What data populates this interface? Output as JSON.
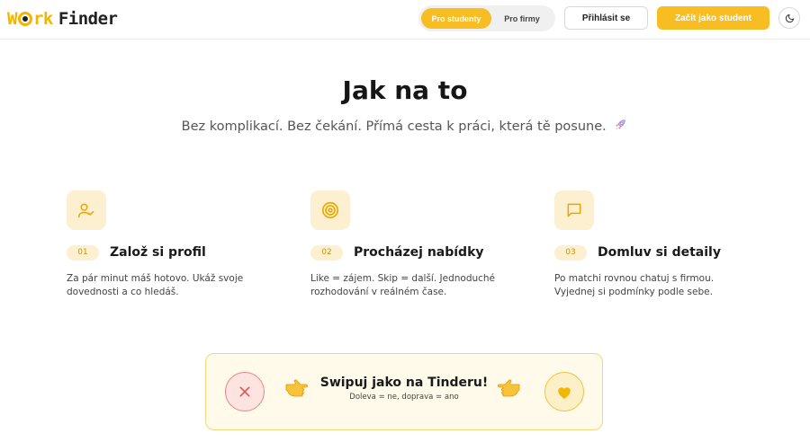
{
  "header": {
    "logo": {
      "part1": "W",
      "part2": "rk",
      "part3": "Finder"
    },
    "toggle": {
      "active": "Pro studenty",
      "inactive": "Pro firmy"
    },
    "login_label": "Přihlásit se",
    "start_label": "Začít jako student",
    "theme_icon": "moon-icon"
  },
  "hero": {
    "title": "Jak na to",
    "subtitle": "Bez komplikací. Bez čekání. Přímá cesta k práci, která tě posune."
  },
  "steps": [
    {
      "num": "01",
      "title": "Založ si profil",
      "desc": "Za pár minut máš hotovo. Ukáž svoje dovednosti a co hledáš.",
      "icon": "user-check-icon"
    },
    {
      "num": "02",
      "title": "Procházej nabídky",
      "desc": "Like = zájem. Skip = další. Jednoduché rozhodování v reálném čase.",
      "icon": "target-icon"
    },
    {
      "num": "03",
      "title": "Domluv si detaily",
      "desc": "Po matchi rovnou chatuj s firmou. Vyjednej si podmínky podle sebe.",
      "icon": "message-icon"
    }
  ],
  "swipe": {
    "title": "Swipuj jako na Tinderu!",
    "subtitle": "Doleva = ne, doprava = ano",
    "left_icon": "close-icon",
    "right_icon": "heart-icon"
  },
  "colors": {
    "accent": "#f7bd22",
    "accent_light": "#fdf0d0",
    "reject": "#e0535b"
  }
}
